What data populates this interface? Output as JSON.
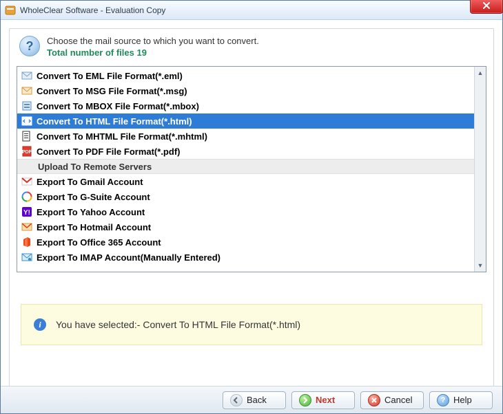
{
  "window": {
    "title": "WholeClear Software - Evaluation Copy"
  },
  "header": {
    "instruction": "Choose the mail source to which you want to convert.",
    "file_count_label": "Total number of files 19"
  },
  "options": [
    {
      "label": "Convert To EML File Format(*.eml)",
      "icon": "eml",
      "selected": false
    },
    {
      "label": "Convert To MSG File Format(*.msg)",
      "icon": "msg",
      "selected": false
    },
    {
      "label": "Convert To MBOX File Format(*.mbox)",
      "icon": "mbox",
      "selected": false
    },
    {
      "label": "Convert To HTML File Format(*.html)",
      "icon": "html",
      "selected": true
    },
    {
      "label": "Convert To MHTML File Format(*.mhtml)",
      "icon": "mhtml",
      "selected": false
    },
    {
      "label": "Convert To PDF File Format(*.pdf)",
      "icon": "pdf",
      "selected": false
    }
  ],
  "section_label": "Upload To Remote Servers",
  "remote_options": [
    {
      "label": "Export To Gmail Account",
      "icon": "gmail"
    },
    {
      "label": "Export To G-Suite Account",
      "icon": "gsuite"
    },
    {
      "label": "Export To Yahoo Account",
      "icon": "yahoo"
    },
    {
      "label": "Export To Hotmail Account",
      "icon": "hotmail"
    },
    {
      "label": "Export To Office 365 Account",
      "icon": "o365"
    },
    {
      "label": "Export To IMAP Account(Manually Entered)",
      "icon": "imap"
    }
  ],
  "notice": {
    "text": "You have selected:- Convert To HTML File Format(*.html)"
  },
  "buttons": {
    "back": "Back",
    "next": "Next",
    "cancel": "Cancel",
    "help": "Help"
  }
}
